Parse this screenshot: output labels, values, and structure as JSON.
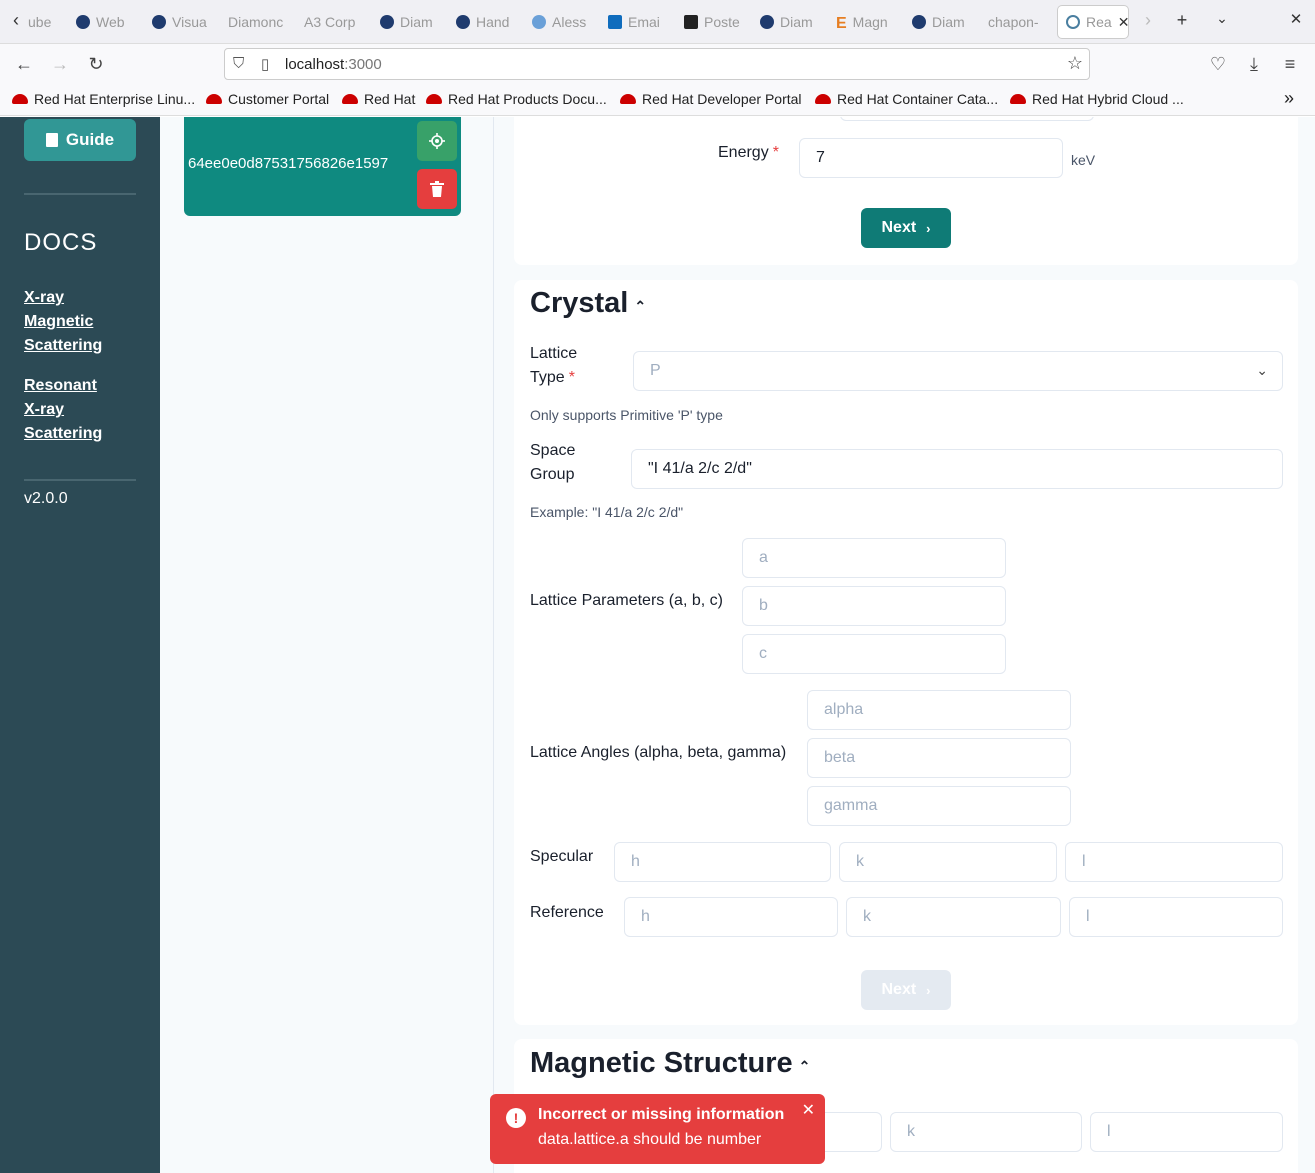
{
  "browser": {
    "tabs": [
      "ube",
      "Web",
      "Visua",
      "Diamonc",
      "A3 Corp",
      "Diam",
      "Hand",
      "Aless",
      "Emai",
      "Poste",
      "Diam",
      "Magn",
      "Diam",
      "chapon-",
      "Rea"
    ],
    "url_host": "localhost",
    "url_port": ":3000",
    "bookmarks": [
      "Red Hat Enterprise Linu...",
      "Customer Portal",
      "Red Hat",
      "Red Hat Products Docu...",
      "Red Hat Developer Portal",
      "Red Hat Container Cata...",
      "Red Hat Hybrid Cloud ..."
    ]
  },
  "sidebar": {
    "guide_label": "Guide",
    "docs_title": "DOCS",
    "links": [
      {
        "lines": [
          "X-ray",
          "Magnetic",
          "Scattering"
        ]
      },
      {
        "lines": [
          "Resonant",
          "X-ray",
          "Scattering"
        ]
      }
    ],
    "version": "v2.0.0"
  },
  "session": {
    "id": "64ee0e0d87531756826e1597"
  },
  "beam": {
    "energy_label": "Energy",
    "energy_value": "7",
    "energy_unit": "keV",
    "next_label": "Next"
  },
  "crystal": {
    "title": "Crystal",
    "lattice_type_label_1": "Lattice",
    "lattice_type_label_2": "Type",
    "lattice_type_value": "P",
    "lattice_type_help": "Only supports Primitive 'P' type",
    "space_group_label_1": "Space",
    "space_group_label_2": "Group",
    "space_group_value": "\"I 41/a 2/c 2/d\"",
    "space_group_help": "Example: \"I 41/a 2/c 2/d\"",
    "lattice_params_label": "Lattice Parameters (a, b, c)",
    "param_placeholders": [
      "a",
      "b",
      "c"
    ],
    "lattice_angles_label": "Lattice Angles (alpha, beta, gamma)",
    "angle_placeholders": [
      "alpha",
      "beta",
      "gamma"
    ],
    "specular_label": "Specular",
    "reference_label": "Reference",
    "hkl_placeholders": [
      "h",
      "k",
      "l"
    ],
    "next_label": "Next"
  },
  "magnetic": {
    "title": "Magnetic Structure",
    "placeholders": [
      "k",
      "l"
    ]
  },
  "toast": {
    "title": "Incorrect or missing information",
    "detail": "data.lattice.a should be number"
  }
}
